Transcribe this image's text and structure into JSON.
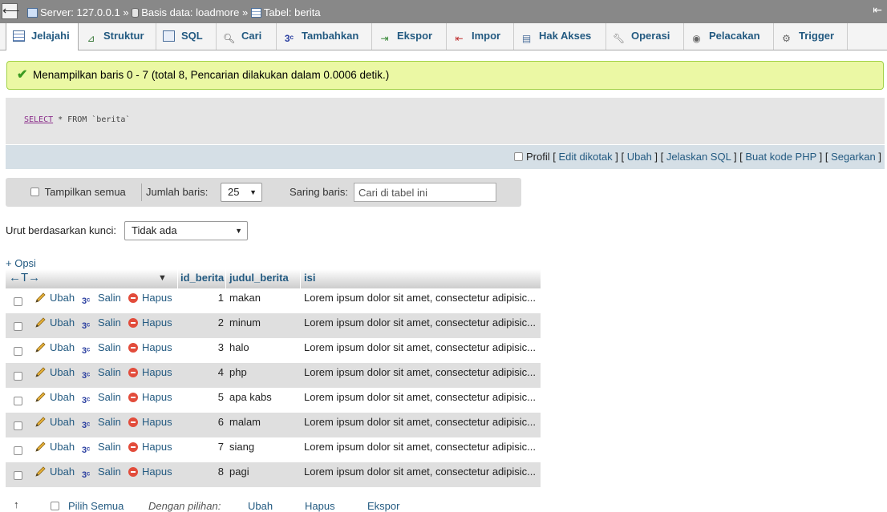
{
  "breadcrumb": {
    "back_symbol": "⟵",
    "server": "Server: 127.0.0.1",
    "sep": "»",
    "database": "Basis data: loadmore",
    "table": "Tabel: berita",
    "collapse_symbol": "⇤"
  },
  "tabs": [
    {
      "label": "Jelajahi",
      "icon": "browse-icon"
    },
    {
      "label": "Struktur",
      "icon": "structure-icon"
    },
    {
      "label": "SQL",
      "icon": "sql-icon"
    },
    {
      "label": "Cari",
      "icon": "search-icon"
    },
    {
      "label": "Tambahkan",
      "icon": "insert-icon"
    },
    {
      "label": "Ekspor",
      "icon": "export-icon"
    },
    {
      "label": "Impor",
      "icon": "import-icon"
    },
    {
      "label": "Hak Akses",
      "icon": "privileges-icon"
    },
    {
      "label": "Operasi",
      "icon": "operations-icon"
    },
    {
      "label": "Pelacakan",
      "icon": "tracking-icon"
    },
    {
      "label": "Trigger",
      "icon": "trigger-icon"
    }
  ],
  "message": "Menampilkan baris 0 - 7 (total 8, Pencarian dilakukan dalam 0.0006 detik.)",
  "sql": {
    "keyword": "SELECT",
    "rest": " * FROM `berita`"
  },
  "sql_links": {
    "profile": "Profil",
    "edit_inline": "Edit dikotak",
    "edit": "Ubah",
    "explain": "Jelaskan SQL",
    "create_php": "Buat kode PHP",
    "refresh": "Segarkan"
  },
  "nav": {
    "show_all": "Tampilkan semua",
    "rows_label": "Jumlah baris:",
    "rows_value": "25",
    "filter_label": "Saring baris:",
    "filter_placeholder": "Cari di tabel ini"
  },
  "sort": {
    "label": "Urut berdasarkan kunci:",
    "value": "Tidak ada"
  },
  "options_link": "+ Opsi",
  "table": {
    "columns": [
      "id_berita",
      "judul_berita",
      "isi"
    ],
    "actions": {
      "edit": "Ubah",
      "copy": "Salin",
      "delete": "Hapus"
    },
    "rows": [
      {
        "id": "1",
        "judul": "makan",
        "isi": "Lorem ipsum dolor sit amet, consectetur adipisic..."
      },
      {
        "id": "2",
        "judul": "minum",
        "isi": "Lorem ipsum dolor sit amet, consectetur adipisic..."
      },
      {
        "id": "3",
        "judul": "halo",
        "isi": "Lorem ipsum dolor sit amet, consectetur adipisic..."
      },
      {
        "id": "4",
        "judul": "php",
        "isi": "Lorem ipsum dolor sit amet, consectetur adipisic..."
      },
      {
        "id": "5",
        "judul": "apa kabs",
        "isi": "Lorem ipsum dolor sit amet, consectetur adipisic..."
      },
      {
        "id": "6",
        "judul": "malam",
        "isi": "Lorem ipsum dolor sit amet, consectetur adipisic..."
      },
      {
        "id": "7",
        "judul": "siang",
        "isi": "Lorem ipsum dolor sit amet, consectetur adipisic..."
      },
      {
        "id": "8",
        "judul": "pagi",
        "isi": "Lorem ipsum dolor sit amet, consectetur adipisic..."
      }
    ]
  },
  "footer": {
    "select_all": "Pilih Semua",
    "with_selected": "Dengan pilihan:",
    "edit": "Ubah",
    "delete": "Hapus",
    "export": "Ekspor"
  }
}
